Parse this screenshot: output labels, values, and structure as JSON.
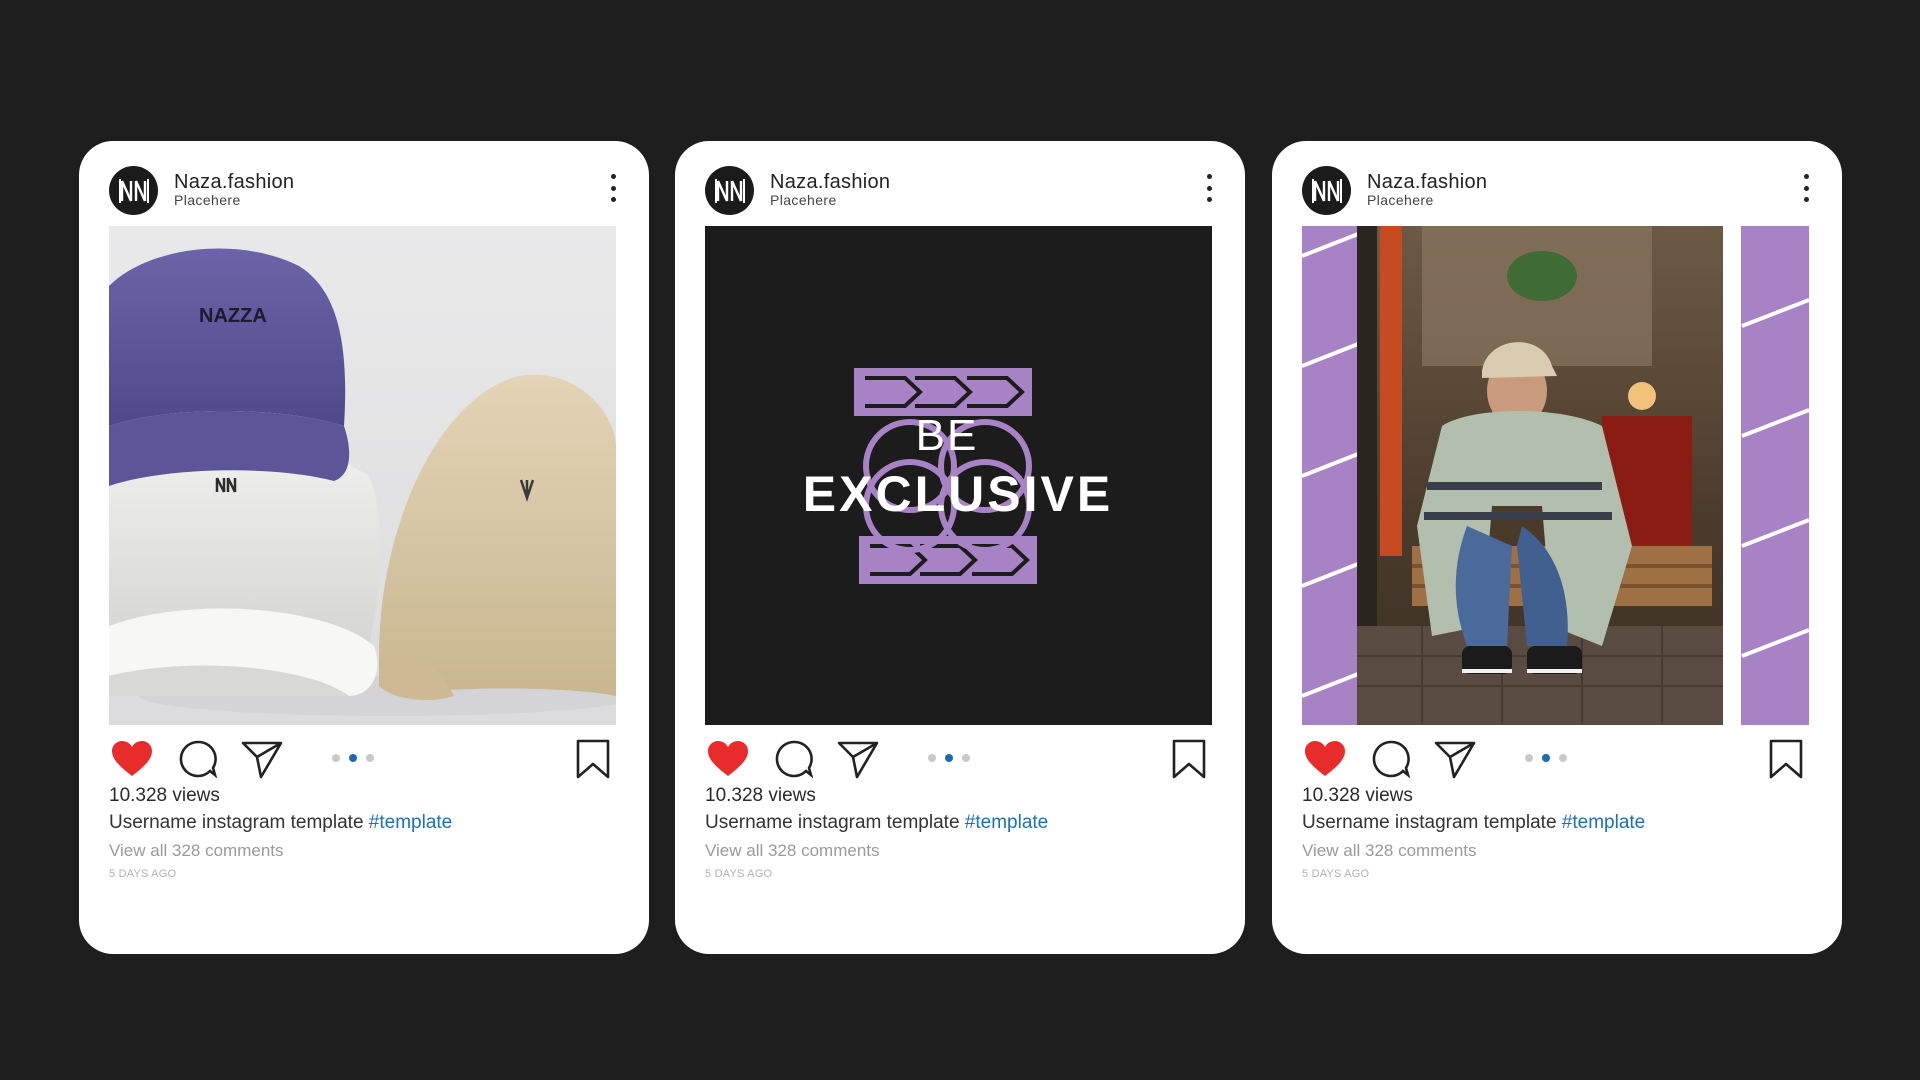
{
  "colors": {
    "background": "#1e1e1e",
    "card": "#ffffff",
    "like": "#e82c2c",
    "hashtag": "#1f6fb3",
    "accent_purple": "#a783c6",
    "dot_active": "#1e6ab0"
  },
  "posts": [
    {
      "account": {
        "name": "Naza.fashion",
        "location": "Placehere",
        "avatar_icon": "naza-logo-icon"
      },
      "image": {
        "kind": "caps-photo",
        "cap_text": "NAZZA"
      },
      "liked": true,
      "carousel": {
        "count": 3,
        "active": 1
      },
      "views": "10.328 views",
      "caption": {
        "user": "Username",
        "text": " instagram template ",
        "hashtag": "#template"
      },
      "comments": "View all 328 comments",
      "time": "5 DAYS AGO"
    },
    {
      "account": {
        "name": "Naza.fashion",
        "location": "Placehere",
        "avatar_icon": "naza-logo-icon"
      },
      "image": {
        "kind": "be-exclusive-graphic",
        "line1": "BE",
        "line2": "EXCLUSIVE"
      },
      "liked": true,
      "carousel": {
        "count": 3,
        "active": 1
      },
      "views": "10.328 views",
      "caption": {
        "user": "Username",
        "text": " instagram template ",
        "hashtag": "#template"
      },
      "comments": "View all 328 comments",
      "time": "5 DAYS AGO"
    },
    {
      "account": {
        "name": "Naza.fashion",
        "location": "Placehere",
        "avatar_icon": "naza-logo-icon"
      },
      "image": {
        "kind": "model-photo-purple-frame"
      },
      "liked": true,
      "carousel": {
        "count": 3,
        "active": 1
      },
      "views": "10.328 views",
      "caption": {
        "user": "Username",
        "text": " instagram template ",
        "hashtag": "#template"
      },
      "comments": "View all 328 comments",
      "time": "5 DAYS AGO"
    }
  ]
}
